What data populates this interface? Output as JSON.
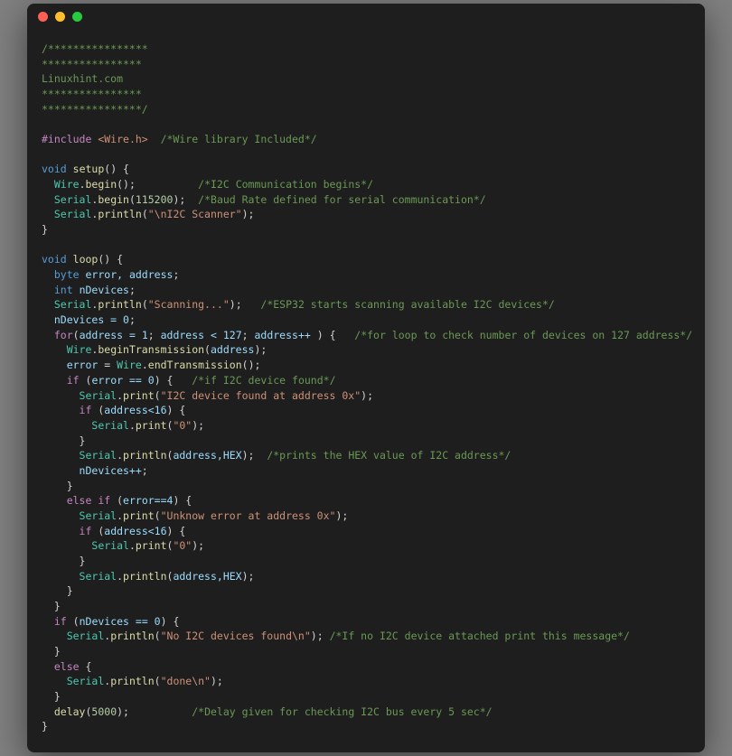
{
  "titlebar": {
    "buttons": [
      "close",
      "minimize",
      "zoom"
    ]
  },
  "code": {
    "header_comment": "/****************\n****************\nLinuxhint.com\n****************\n****************/",
    "include": {
      "directive": "#include",
      "header": "<Wire.h>",
      "comment": "/*Wire library Included*/"
    },
    "setup": {
      "sig": {
        "ret": "void",
        "name": "setup"
      },
      "l1": {
        "obj": "Wire",
        "fn": "begin",
        "comment": "/*I2C Communication begins*/"
      },
      "l2": {
        "obj": "Serial",
        "fn": "begin",
        "arg": "115200",
        "comment": "/*Baud Rate defined for serial communication*/"
      },
      "l3": {
        "obj": "Serial",
        "fn": "println",
        "arg": "\"\\nI2C Scanner\""
      }
    },
    "loop": {
      "sig": {
        "ret": "void",
        "name": "loop"
      },
      "decl1": {
        "type": "byte",
        "vars": "error, address"
      },
      "decl2": {
        "type": "int",
        "vars": "nDevices"
      },
      "scan": {
        "obj": "Serial",
        "fn": "println",
        "arg": "\"Scanning...\"",
        "comment": "/*ESP32 starts scanning available I2C devices*/"
      },
      "init": "nDevices = 0",
      "for": {
        "kw": "for",
        "init": "address = 1",
        "cond": "address < 127",
        "inc": "address++",
        "comment": "/*for loop to check number of devices on 127 address*/"
      },
      "bt": {
        "obj": "Wire",
        "fn": "beginTransmission",
        "arg": "address"
      },
      "et": {
        "lhs": "error",
        "obj": "Wire",
        "fn": "endTransmission"
      },
      "if0": {
        "kw": "if",
        "cond": "error == 0",
        "comment": "/*if I2C device found*/"
      },
      "p1": {
        "obj": "Serial",
        "fn": "print",
        "arg": "\"I2C device found at address 0x\""
      },
      "if16a": {
        "kw": "if",
        "cond": "address<16"
      },
      "p0a": {
        "obj": "Serial",
        "fn": "print",
        "arg": "\"0\""
      },
      "phex": {
        "obj": "Serial",
        "fn": "println",
        "args": "address,HEX",
        "comment": "/*prints the HEX value of I2C address*/"
      },
      "incn": "nDevices++",
      "elif": {
        "kw": "else if",
        "cond": "error==4"
      },
      "p2": {
        "obj": "Serial",
        "fn": "print",
        "arg": "\"Unknow error at address 0x\""
      },
      "if16b": {
        "kw": "if",
        "cond": "address<16"
      },
      "p0b": {
        "obj": "Serial",
        "fn": "print",
        "arg": "\"0\""
      },
      "phex2": {
        "obj": "Serial",
        "fn": "println",
        "args": "address,HEX"
      },
      "ifnd": {
        "kw": "if",
        "cond": "nDevices == 0"
      },
      "pno": {
        "obj": "Serial",
        "fn": "println",
        "arg": "\"No I2C devices found\\n\"",
        "comment": "/*If no I2C device attached print this message*/"
      },
      "else": {
        "kw": "else"
      },
      "pdone": {
        "obj": "Serial",
        "fn": "println",
        "arg": "\"done\\n\""
      },
      "delay": {
        "fn": "delay",
        "arg": "5000",
        "comment": "/*Delay given for checking I2C bus every 5 sec*/"
      }
    }
  }
}
